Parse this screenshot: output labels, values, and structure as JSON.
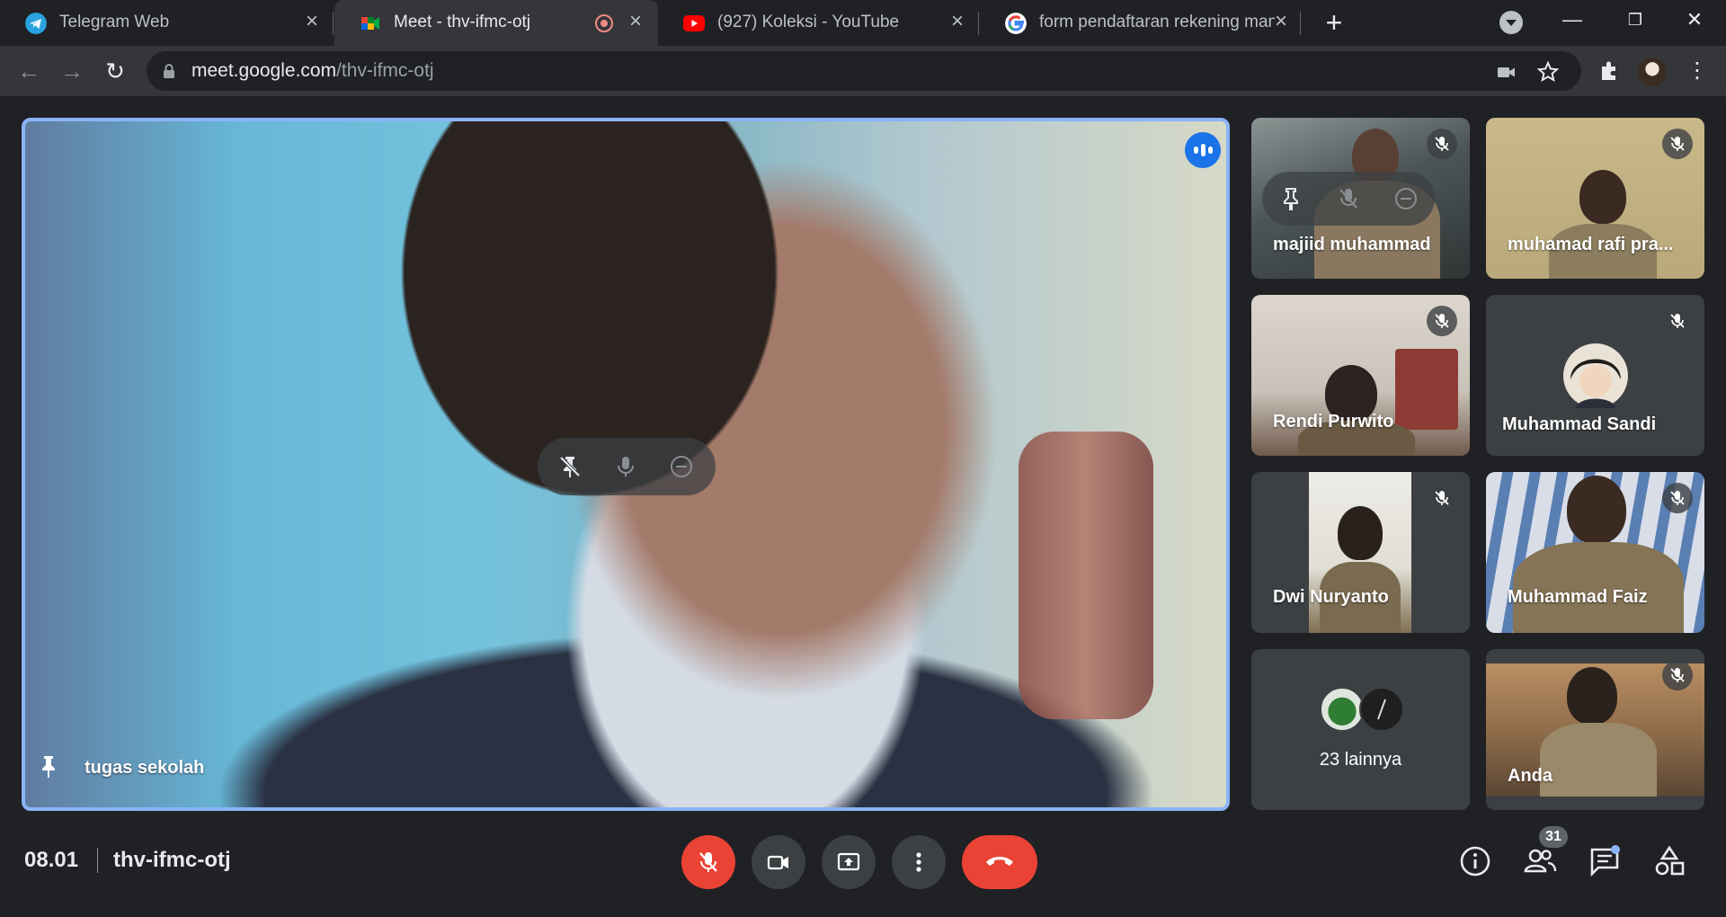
{
  "browser": {
    "tabs": [
      {
        "title": "Telegram Web",
        "icon": "telegram-icon"
      },
      {
        "title": "Meet - thv-ifmc-otj",
        "icon": "google-meet-icon",
        "recording": true
      },
      {
        "title": "(927) Koleksi - YouTube",
        "icon": "youtube-icon"
      },
      {
        "title": "form pendaftaran rekening manc",
        "icon": "google-icon"
      }
    ],
    "url_domain": "meet.google.com",
    "url_path": "/thv-ifmc-otj"
  },
  "meet": {
    "main_tile": {
      "name": "tugas sekolah"
    },
    "participants": [
      {
        "name": "majiid muhammad",
        "muted": true
      },
      {
        "name": "muhamad rafi pra...",
        "muted": true
      },
      {
        "name": "Rendi Purwito",
        "muted": true
      },
      {
        "name": "Muhammad Sandi",
        "muted": true
      },
      {
        "name": "Dwi Nuryanto",
        "muted": true
      },
      {
        "name": "Muhammad Faiz",
        "muted": true
      },
      {
        "name": "Anda",
        "muted": true
      }
    ],
    "more_label": "23 lainnya",
    "time": "08.01",
    "meeting_code": "thv-ifmc-otj",
    "people_count": "31"
  },
  "colors": {
    "accent_blue": "#8ab4f8",
    "end_call_red": "#ea4335",
    "background": "#202124",
    "tile": "#3c4043"
  }
}
